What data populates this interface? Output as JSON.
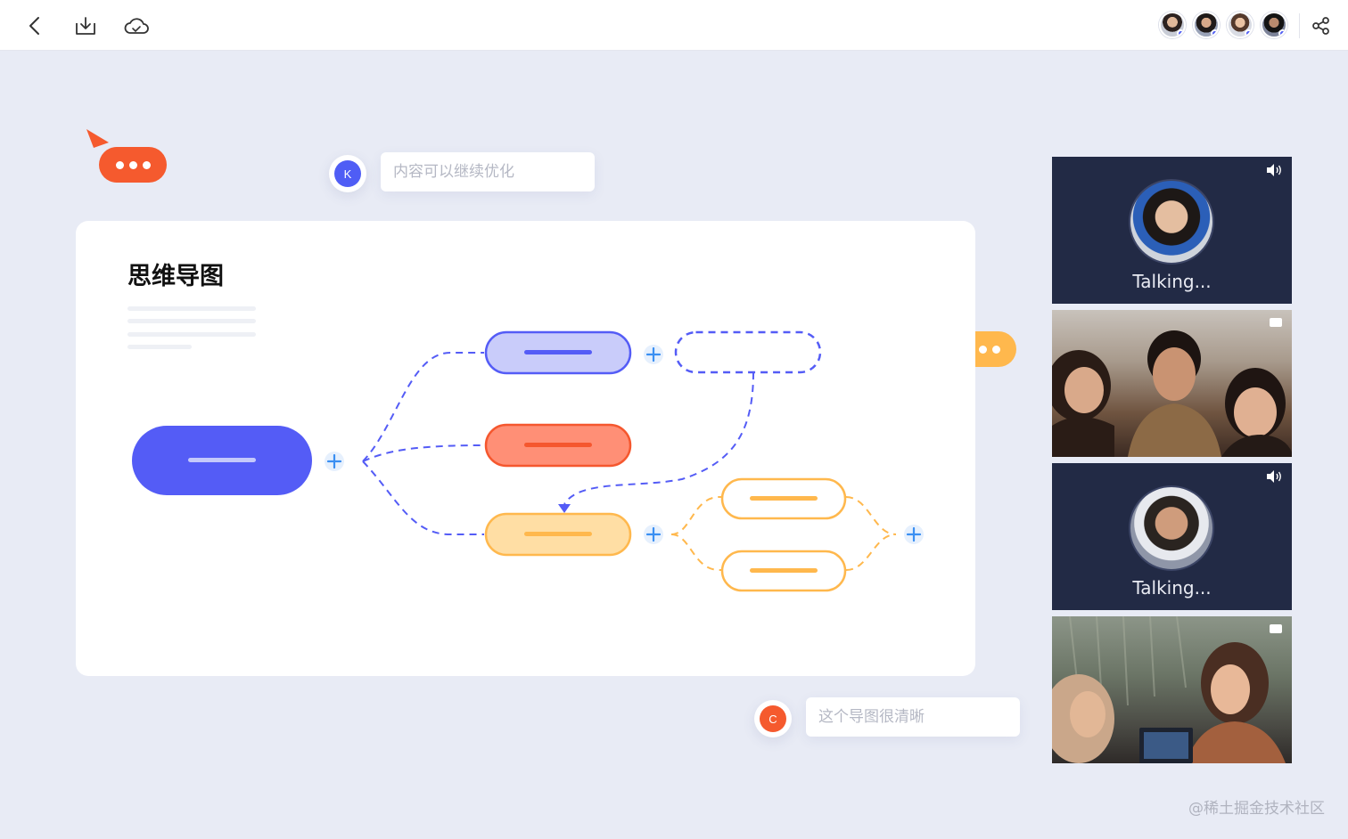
{
  "toolbar": {
    "back": "back",
    "download": "download",
    "cloud": "cloud-sync",
    "share": "share"
  },
  "collaborators": [
    {
      "name": "collaborator-1"
    },
    {
      "name": "collaborator-2"
    },
    {
      "name": "collaborator-3"
    },
    {
      "name": "collaborator-4"
    }
  ],
  "comments": {
    "top": {
      "avatar_letter": "K",
      "placeholder": "内容可以继续优化",
      "avatar_color": "#4f5df5"
    },
    "bottom": {
      "avatar_letter": "C",
      "placeholder": "这个导图很清晰",
      "avatar_color": "#f55a2e"
    }
  },
  "card": {
    "title": "思维导图"
  },
  "mindmap": {
    "colors": {
      "root": "#545cf6",
      "purple_fill": "#c9ccfa",
      "purple_stroke": "#545cf6",
      "red_fill": "#ff8f76",
      "red_stroke": "#f5572e",
      "yellow_fill": "#ffdea4",
      "yellow_stroke": "#ffb84d",
      "plus": "#3a8ff2"
    }
  },
  "typing_colors": {
    "left": "#f55a2e",
    "right": "#ffb84d"
  },
  "video_tiles": [
    {
      "label": "Talking...",
      "kind": "speaker",
      "status_icon": "speaker-icon"
    },
    {
      "label": "",
      "kind": "photo",
      "status_icon": "camera-icon"
    },
    {
      "label": "Talking...",
      "kind": "speaker",
      "status_icon": "speaker-icon"
    },
    {
      "label": "",
      "kind": "photo",
      "status_icon": "camera-icon"
    }
  ],
  "watermark": "@稀土掘金技术社区"
}
